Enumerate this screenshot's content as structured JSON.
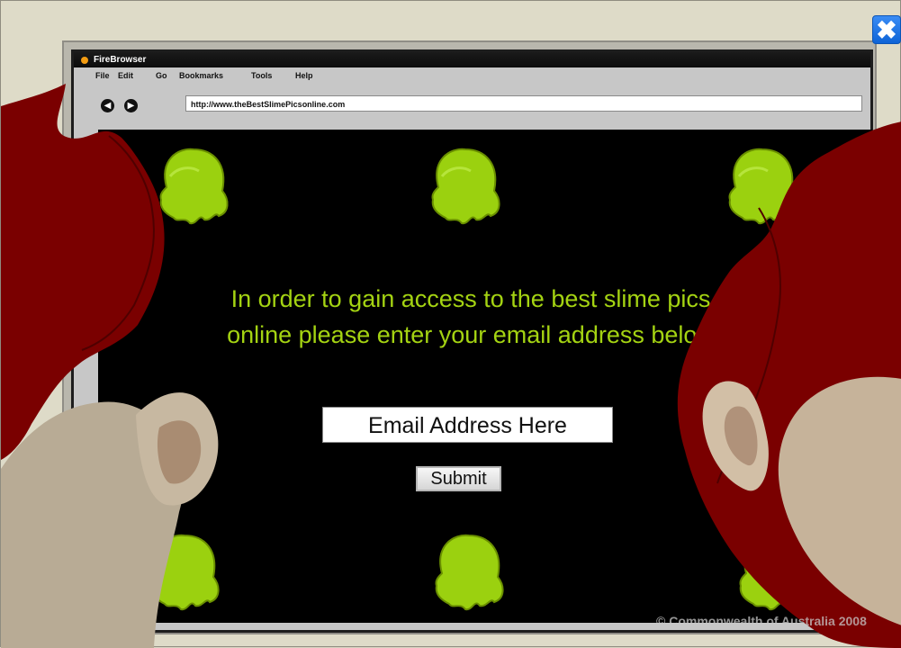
{
  "browser": {
    "title": "FireBrowser",
    "menu_items": [
      "File",
      "Edit",
      "Go",
      "Bookmarks",
      "Tools",
      "Help"
    ],
    "url": "http://www.theBestSlimePicsonline.com"
  },
  "page": {
    "prompt_text": "In order to gain access to the best slime pics online please enter your email address below",
    "email_placeholder": "Email Address Here",
    "submit_label": "Submit"
  },
  "footer": {
    "copyright": "© Commonwealth of Australia 2008"
  },
  "icons": {
    "back": "back-arrow-icon",
    "forward": "forward-arrow-icon",
    "close": "close-icon",
    "slime": "slime-icon"
  },
  "colors": {
    "slime": "#9bd10f",
    "page_bg": "#000000",
    "prompt_text": "#a4d312",
    "hair_red": "#7a0000"
  }
}
